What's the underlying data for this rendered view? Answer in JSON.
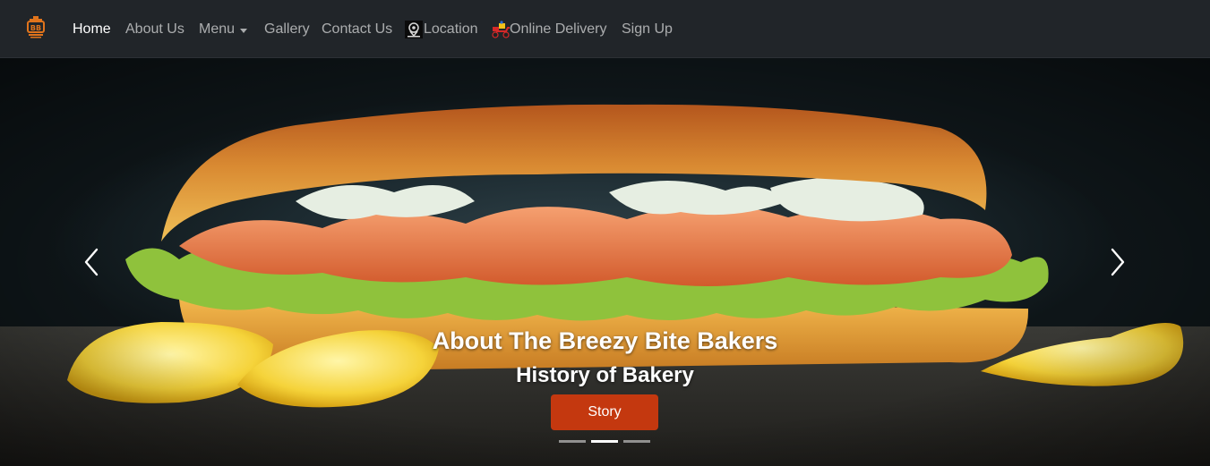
{
  "navbar": {
    "brand_icon": "bakery-logo-icon",
    "items": [
      {
        "label": "Home",
        "active": true
      },
      {
        "label": "About Us"
      },
      {
        "label": "Menu",
        "dropdown": true
      },
      {
        "label": "Gallery"
      },
      {
        "label": "Contact Us"
      },
      {
        "label": "Location",
        "icon": "location-icon"
      },
      {
        "label": "Online Delivery",
        "icon": "delivery-scooter-icon"
      },
      {
        "label": "Sign Up"
      }
    ]
  },
  "carousel": {
    "image": "shrimp-sandwich-with-lemon",
    "caption_title": "About The Breezy Bite Bakers",
    "caption_subtitle": "History of Bakery",
    "button_label": "Story",
    "prev_icon": "chevron-left-icon",
    "next_icon": "chevron-right-icon",
    "slide_count": 3,
    "active_slide": 2
  },
  "colors": {
    "navbar_bg": "#212529",
    "accent": "#c4380f",
    "brand": "#e0741c"
  }
}
